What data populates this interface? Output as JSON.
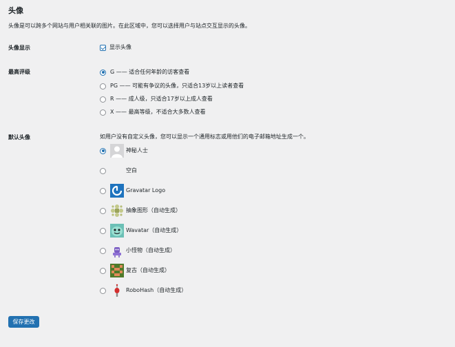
{
  "page": {
    "title": "头像",
    "description": "头像是可以跨多个网站与用户相关联的图片。在此区域中，您可以选择用户与站点交互显示的头像。"
  },
  "show_avatars": {
    "label": "头像显示",
    "checkbox_label": "显示头像",
    "checked": true
  },
  "rating": {
    "label": "最高评级",
    "options": [
      {
        "text": "G —— 适合任何年龄的访客查看",
        "checked": true
      },
      {
        "text": "PG —— 可能有争议的头像，只适合13岁以上读者查看",
        "checked": false
      },
      {
        "text": "R —— 成人级，只适合17岁以上成人查看",
        "checked": false
      },
      {
        "text": "X —— 最高等级，不适合大多数人查看",
        "checked": false
      }
    ]
  },
  "default_avatar": {
    "label": "默认头像",
    "description": "如用户没有自定义头像，您可以显示一个通用标志或用他们的电子邮箱地址生成一个。",
    "options": [
      {
        "text": "神秘人士",
        "icon": "mystery-person-avatar",
        "checked": true
      },
      {
        "text": "空白",
        "icon": "blank-avatar",
        "checked": false
      },
      {
        "text": "Gravatar Logo",
        "icon": "gravatar-logo-avatar",
        "checked": false
      },
      {
        "text": "抽象图形（自动生成）",
        "icon": "identicon-avatar",
        "checked": false
      },
      {
        "text": "Wavatar（自动生成）",
        "icon": "wavatar-avatar",
        "checked": false
      },
      {
        "text": "小怪物（自动生成）",
        "icon": "monsterid-avatar",
        "checked": false
      },
      {
        "text": "复古（自动生成）",
        "icon": "retro-avatar",
        "checked": false
      },
      {
        "text": "RoboHash（自动生成）",
        "icon": "robohash-avatar",
        "checked": false
      }
    ]
  },
  "footer": {
    "save_label": "保存更改"
  },
  "colors": {
    "accent": "#2271b1",
    "background": "#f0f0f1",
    "text": "#1d2327"
  }
}
